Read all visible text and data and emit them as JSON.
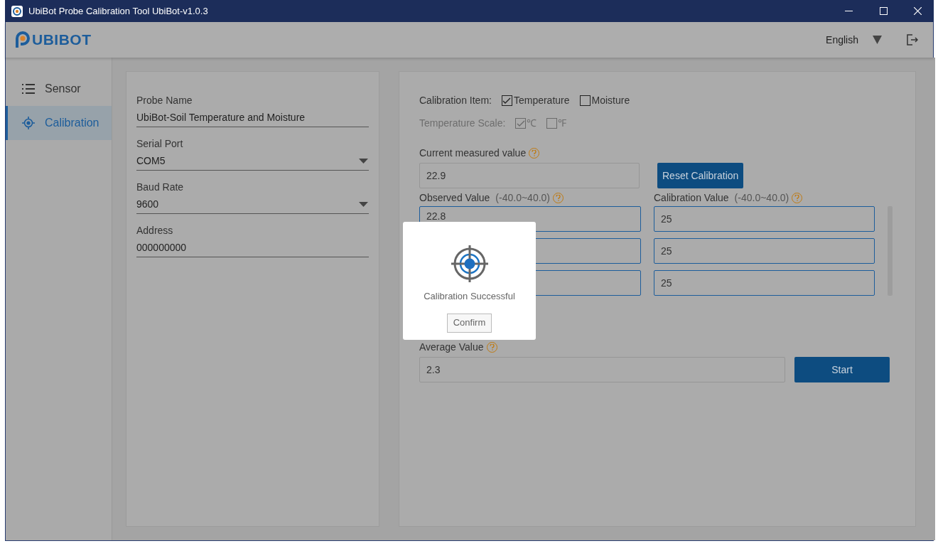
{
  "window": {
    "title": "UbiBot Probe Calibration Tool UbiBot-v1.0.3"
  },
  "header": {
    "logo": "UBIBOT",
    "language": "English"
  },
  "sidebar": {
    "items": [
      {
        "label": "Sensor",
        "kind": "list",
        "selected": false
      },
      {
        "label": "Calibration",
        "kind": "target",
        "selected": true
      }
    ]
  },
  "probe_fields": [
    {
      "label": "Probe Name",
      "value": "UbiBot-Soil Temperature and Moisture",
      "kind": "text"
    },
    {
      "label": "Serial Port",
      "value": "COM5",
      "kind": "select"
    },
    {
      "label": "Baud Rate",
      "value": "9600",
      "kind": "select"
    },
    {
      "label": "Address",
      "value": "000000000",
      "kind": "text"
    }
  ],
  "calibration_item": {
    "label": "Calibration Item:",
    "options": [
      {
        "label": "Temperature",
        "checked": true
      },
      {
        "label": "Moisture",
        "checked": false
      }
    ]
  },
  "temperature_scale": {
    "label": "Temperature Scale:",
    "disabled": true,
    "options": [
      {
        "label": "℃",
        "checked": true
      },
      {
        "label": "℉",
        "checked": false
      }
    ]
  },
  "current_value": {
    "label": "Current measured value",
    "value": "22.9"
  },
  "reset_button": "Reset Calibration",
  "observed_header": {
    "label": "Observed Value",
    "range": "(-40.0~40.0)"
  },
  "calibration_header": {
    "label": "Calibration Value",
    "range": "(-40.0~40.0)"
  },
  "rows": [
    {
      "observed": "22.8",
      "calibration": "25"
    },
    {
      "calibration": "25"
    },
    {
      "calibration": "25"
    }
  ],
  "average": {
    "label": "Average Value",
    "value": "2.3"
  },
  "start_button": "Start",
  "dialog": {
    "message": "Calibration Successful",
    "button": "Confirm"
  }
}
